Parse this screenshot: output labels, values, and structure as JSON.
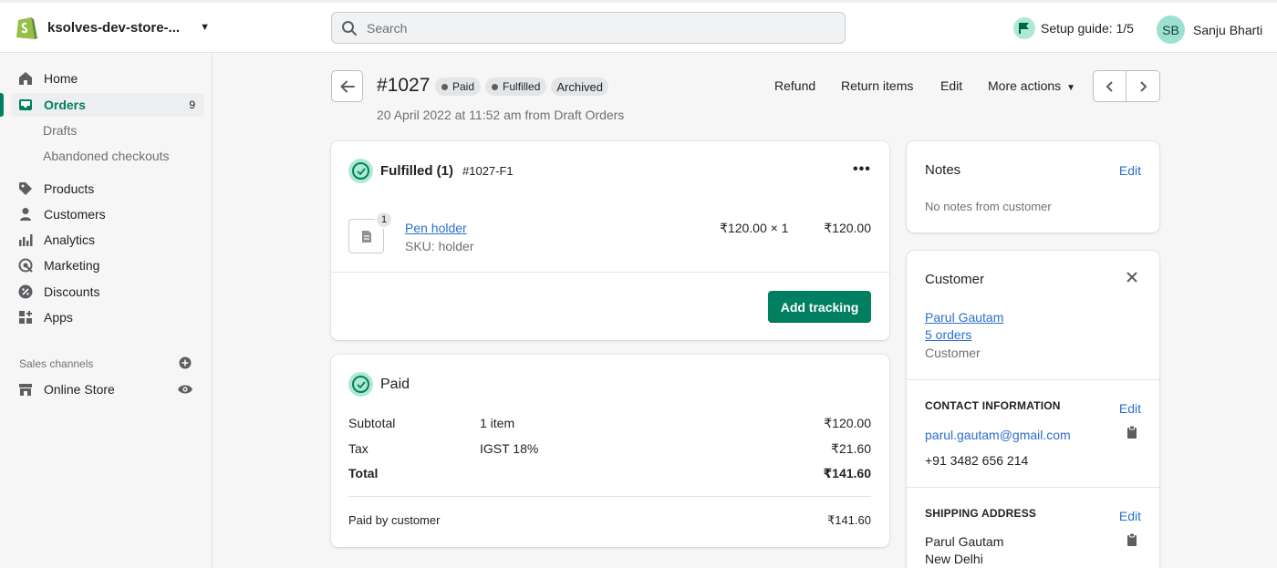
{
  "topbar": {
    "store_name": "ksolves-dev-store-...",
    "search_placeholder": "Search",
    "setup_guide": "Setup guide: 1/5",
    "user_initials": "SB",
    "user_name": "Sanju Bharti",
    "colors": {
      "brand": "#008060",
      "avatar": "#9ce0d0"
    }
  },
  "sidebar": {
    "home": "Home",
    "orders": "Orders",
    "orders_count": "9",
    "drafts": "Drafts",
    "abandoned": "Abandoned checkouts",
    "products": "Products",
    "customers": "Customers",
    "analytics": "Analytics",
    "marketing": "Marketing",
    "discounts": "Discounts",
    "apps": "Apps",
    "sales_channels": "Sales channels",
    "online_store": "Online Store"
  },
  "order": {
    "number": "#1027",
    "status_paid": "Paid",
    "status_fulfilled": "Fulfilled",
    "status_archived": "Archived",
    "date": "20 April 2022 at 11:52 am from Draft Orders",
    "actions": {
      "refund": "Refund",
      "return_items": "Return items",
      "edit": "Edit",
      "more_actions": "More actions"
    }
  },
  "fulfilled_card": {
    "title": "Fulfilled (1)",
    "fulfillment_id": "#1027-F1",
    "item_qty": "1",
    "item_name": "Pen holder",
    "item_sku": "SKU: holder",
    "item_price_qty": "₹120.00 × 1",
    "item_total": "₹120.00",
    "add_tracking": "Add tracking"
  },
  "paid_card": {
    "title": "Paid",
    "subtotal_label": "Subtotal",
    "subtotal_detail": "1 item",
    "subtotal_value": "₹120.00",
    "tax_label": "Tax",
    "tax_detail": "IGST 18%",
    "tax_value": "₹21.60",
    "total_label": "Total",
    "total_value": "₹141.60",
    "paid_by_label": "Paid by customer",
    "paid_by_value": "₹141.60"
  },
  "notes_card": {
    "title": "Notes",
    "edit": "Edit",
    "content": "No notes from customer"
  },
  "customer_card": {
    "title": "Customer",
    "name": "Parul Gautam",
    "orders": "5 orders",
    "type": "Customer",
    "contact_heading": "CONTACT INFORMATION",
    "contact_edit": "Edit",
    "email": "parul.gautam@gmail.com",
    "phone": "+91 3482 656 214",
    "shipping_heading": "SHIPPING ADDRESS",
    "shipping_edit": "Edit",
    "ship_name": "Parul Gautam",
    "ship_city": "New Delhi"
  }
}
